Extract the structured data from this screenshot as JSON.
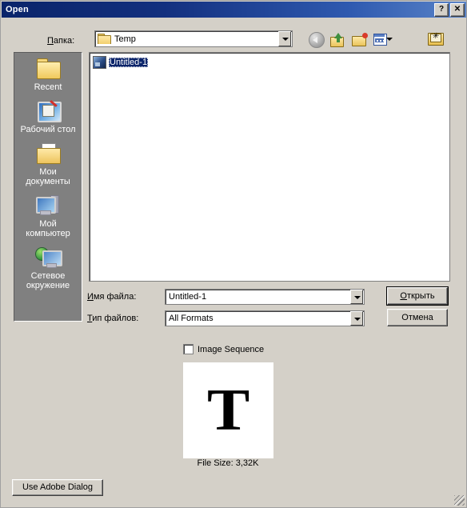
{
  "window": {
    "title": "Open",
    "help_button": "?",
    "close_button": "✕"
  },
  "lookin": {
    "label": "Папка:",
    "label_accel": "П",
    "label_rest": "апка:",
    "value": "Temp",
    "folder_icon": "folder-icon",
    "dropdown_icon": "chevron-down-icon"
  },
  "toolbar": {
    "items": [
      {
        "name": "back-icon",
        "label": "Назад"
      },
      {
        "name": "up-one-level-icon",
        "label": "На один уровень вверх"
      },
      {
        "name": "new-folder-icon",
        "label": "Создание новой папки"
      },
      {
        "name": "views-icon",
        "label": "Меню «Вид»"
      }
    ],
    "special_folder_icon": "favorites-folder-icon"
  },
  "places": {
    "items": [
      {
        "icon": "recent-folder-icon",
        "label": "Recent"
      },
      {
        "icon": "desktop-icon",
        "label": "Рабочий стол"
      },
      {
        "icon": "my-documents-icon",
        "label_line1": "Мои",
        "label_line2": "документы"
      },
      {
        "icon": "my-computer-icon",
        "label_line1": "Мой",
        "label_line2": "компьютер"
      },
      {
        "icon": "network-icon",
        "label_line1": "Сетевое",
        "label_line2": "окружение"
      }
    ]
  },
  "filelist": {
    "items": [
      {
        "icon": "image-file-icon",
        "name": "Untitled-1",
        "selected": true
      }
    ]
  },
  "fields": {
    "filename_label": "Имя файла:",
    "filename_label_accel": "И",
    "filename_label_rest": "мя файла:",
    "filename_value": "Untitled-1",
    "filetype_label": "Тип файлов:",
    "filetype_label_accel": "Т",
    "filetype_label_rest": "ип файлов:",
    "filetype_value": "All Formats"
  },
  "buttons": {
    "open_accel": "О",
    "open_rest": "ткрыть",
    "cancel": "Отмена",
    "use_adobe_dialog": "Use Adobe Dialog"
  },
  "options": {
    "image_sequence_label": "Image Sequence",
    "image_sequence_checked": false
  },
  "preview": {
    "glyph": "T",
    "file_size": "File Size: 3,32K"
  },
  "colors": {
    "dialog_face": "#d4d0c8",
    "titlebar_start": "#0a246a",
    "titlebar_end": "#5a84c8",
    "places_bar": "#808080",
    "selection": "#0a246a",
    "field_background": "#ffffff"
  }
}
